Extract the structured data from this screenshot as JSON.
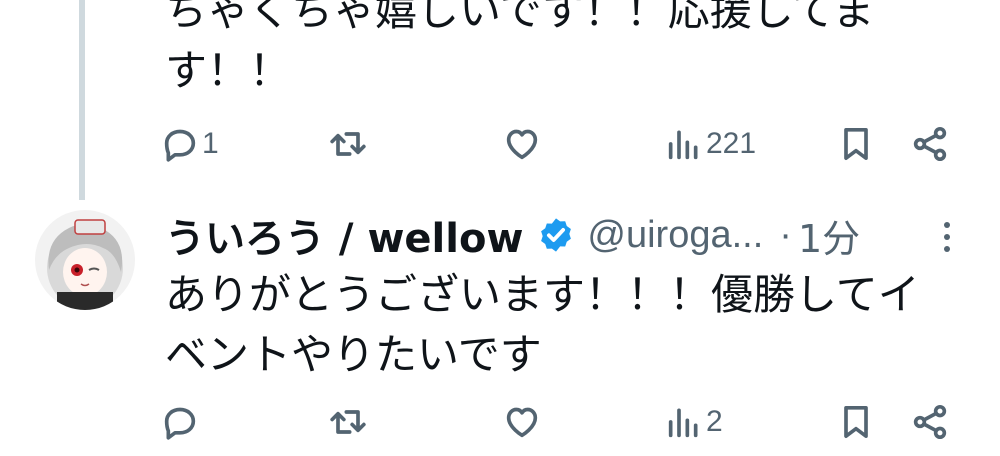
{
  "post1": {
    "text_line1": "ちゃくちゃ嬉しいです！！応援してま",
    "text_line2": "す！！",
    "actions": {
      "reply_count": "1",
      "repost_count": "",
      "like_count": "",
      "view_count": "221"
    }
  },
  "post2": {
    "display_name": "ういろう / wellow",
    "handle": "@uiroga...",
    "separator": "·",
    "time": "1分",
    "text_line1": "ありがとうございます！！！優勝してイ",
    "text_line2": "ベントやりたいです",
    "actions": {
      "reply_count": "",
      "repost_count": "",
      "like_count": "",
      "view_count": "2"
    }
  },
  "colors": {
    "text": "#0f1419",
    "muted": "#536471",
    "verified": "#1d9bf0",
    "thread_line": "#cfd9de"
  },
  "icons": [
    "reply-icon",
    "repost-icon",
    "like-icon",
    "views-icon",
    "bookmark-icon",
    "share-icon",
    "verified-badge-icon",
    "more-icon"
  ]
}
